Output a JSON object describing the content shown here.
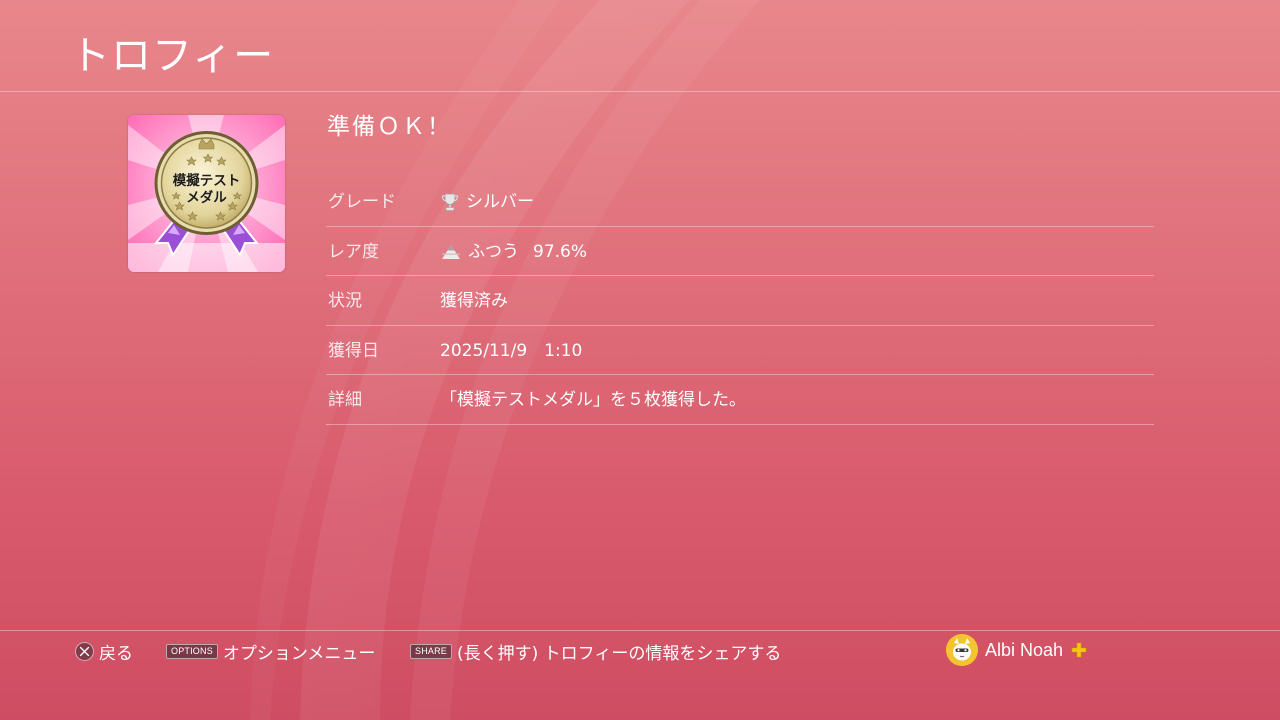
{
  "header": {
    "title": "トロフィー"
  },
  "trophy": {
    "name": "準備ＯＫ！",
    "image_text_line1": "模擬テスト",
    "image_text_line2": "メダル",
    "details": [
      {
        "label": "グレード",
        "value": "シルバー",
        "icon": "silver-trophy-icon"
      },
      {
        "label": "レア度",
        "value": "ふつう",
        "extra": "97.6%",
        "icon": "rarity-common-icon"
      },
      {
        "label": "状況",
        "value": "獲得済み"
      },
      {
        "label": "獲得日",
        "value": "2025/11/9　1:10"
      },
      {
        "label": "詳細",
        "value": "「模擬テストメダル」を５枚獲得した。"
      }
    ]
  },
  "footer": {
    "back_label": "戻る",
    "options_tag": "OPTIONS",
    "options_label": "オプションメニュー",
    "share_tag": "SHARE",
    "share_label": "(長く押す) トロフィーの情報をシェアする",
    "username": "Albi Noah"
  },
  "colors": {
    "background_top": "#e8878b",
    "background_bottom": "#cf4d62",
    "plus_icon": "#f5c518",
    "medal_gold": "#d8c98a",
    "ribbon_purple": "#9b4fd6",
    "burst_pink": "#ff6fb8"
  }
}
